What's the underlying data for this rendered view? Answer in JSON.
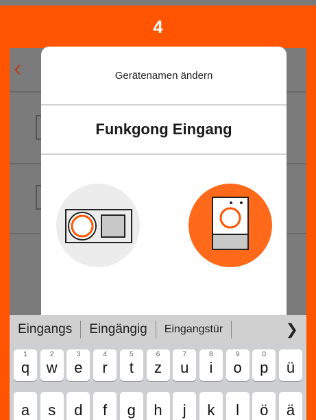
{
  "step_banner": {
    "number": "4"
  },
  "modal": {
    "title": "Gerätenamen ändern",
    "device_name": "Funkgong Eingang",
    "icon_options": [
      {
        "name": "radio-doorbell-icon",
        "selected": false
      },
      {
        "name": "chime-icon",
        "selected": true
      }
    ]
  },
  "keyboard": {
    "suggestions": [
      "Eingangs",
      "Eingängig",
      "Eingangstür"
    ],
    "row1": [
      {
        "main": "q",
        "sub": "1"
      },
      {
        "main": "w",
        "sub": "2"
      },
      {
        "main": "e",
        "sub": "3"
      },
      {
        "main": "r",
        "sub": "4"
      },
      {
        "main": "t",
        "sub": "5"
      },
      {
        "main": "z",
        "sub": "6"
      },
      {
        "main": "u",
        "sub": "7"
      },
      {
        "main": "i",
        "sub": "8"
      },
      {
        "main": "o",
        "sub": "9"
      },
      {
        "main": "p",
        "sub": "0"
      },
      {
        "main": "ü",
        "sub": ""
      }
    ],
    "row2": [
      {
        "main": "a"
      },
      {
        "main": "s"
      },
      {
        "main": "d"
      },
      {
        "main": "f"
      },
      {
        "main": "g"
      },
      {
        "main": "h"
      },
      {
        "main": "j"
      },
      {
        "main": "k"
      },
      {
        "main": "l"
      },
      {
        "main": "ö"
      },
      {
        "main": "ä"
      }
    ]
  },
  "colors": {
    "accent": "#ff5500",
    "overlay": "#7b7b7b"
  }
}
